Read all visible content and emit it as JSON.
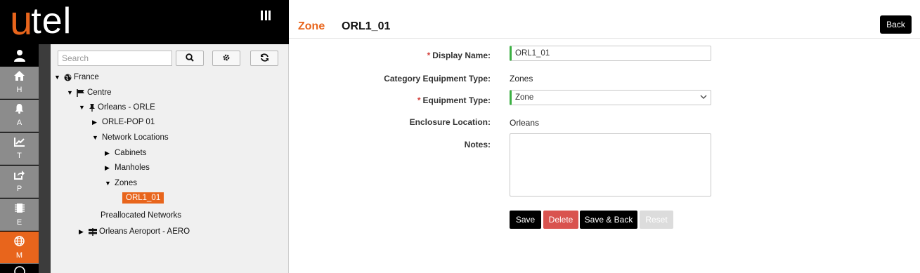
{
  "app": {
    "logo_u": "u",
    "logo_tel": "tel",
    "brand_color": "#e8651c"
  },
  "rail": {
    "items": [
      {
        "letter": "H",
        "icon": "home-icon"
      },
      {
        "letter": "A",
        "icon": "bell-icon"
      },
      {
        "letter": "T",
        "icon": "chart-icon"
      },
      {
        "letter": "P",
        "icon": "share-icon"
      },
      {
        "letter": "E",
        "icon": "chip-icon"
      },
      {
        "letter": "M",
        "icon": "globe-icon",
        "active": true
      }
    ]
  },
  "tree": {
    "search_placeholder": "Search",
    "nodes": {
      "france": "France",
      "centre": "Centre",
      "orleans": "Orleans - ORLE",
      "orle_pop": "ORLE-POP 01",
      "network_locations": "Network Locations",
      "cabinets": "Cabinets",
      "manholes": "Manholes",
      "zones": "Zones",
      "orl1_01": "ORL1_01",
      "preallocated": "Preallocated Networks",
      "orleans_aero": "Orleans Aeroport - AERO"
    }
  },
  "header": {
    "entity_type": "Zone",
    "record_name": "ORL1_01",
    "back_label": "Back"
  },
  "form": {
    "display_name_label": "Display Name:",
    "display_name_value": "ORL1_01",
    "category_label": "Category Equipment Type:",
    "category_value": "Zones",
    "equipment_type_label": "Equipment Type:",
    "equipment_type_value": "Zone",
    "enclosure_label": "Enclosure Location:",
    "enclosure_value": "Orleans",
    "notes_label": "Notes:",
    "required_mark": "*"
  },
  "actions": {
    "save": "Save",
    "delete": "Delete",
    "save_back": "Save & Back",
    "reset": "Reset"
  }
}
